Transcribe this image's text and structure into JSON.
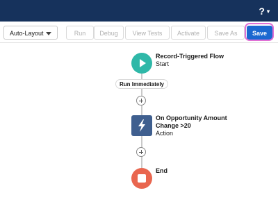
{
  "header": {
    "help_label": "?",
    "help_caret": "▾"
  },
  "toolbar": {
    "layout_select": "Auto-Layout",
    "buttons": {
      "run": "Run",
      "debug": "Debug",
      "view_tests": "View Tests",
      "activate": "Activate",
      "save_as": "Save As",
      "save": "Save"
    }
  },
  "flow": {
    "start": {
      "title": "Record-Triggered Flow",
      "subtitle": "Start"
    },
    "path_label": "Run Immediately",
    "action": {
      "title_line1": "On Opportunity Amount",
      "title_line2": "Change >20",
      "subtitle": "Action"
    },
    "end": {
      "title": "End"
    }
  },
  "colors": {
    "header_bg": "#16325c",
    "save_bg": "#1b68d0",
    "start_node": "#2fb8a8",
    "action_node": "#3f5f8f",
    "end_node": "#e9664f",
    "highlight": "#e070d5"
  }
}
